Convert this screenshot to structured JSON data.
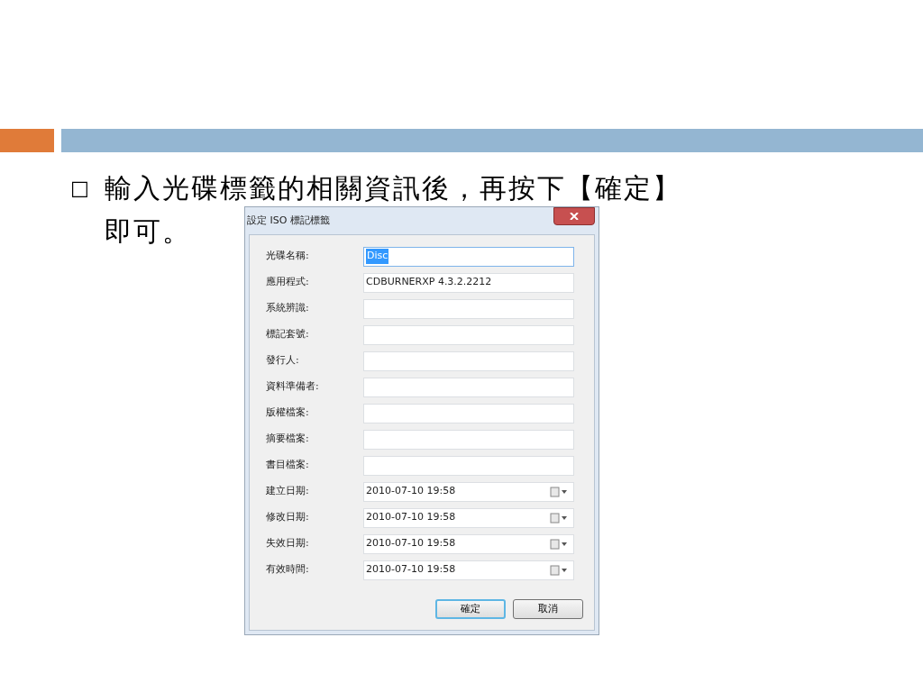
{
  "bullet": {
    "marker": "□",
    "lines": [
      "輸入光碟標籤的相關資訊後，再按下【確定】",
      "即可。"
    ]
  },
  "dialog": {
    "title": "設定 ISO 標記標籤",
    "fields": [
      {
        "label": "光碟名稱:",
        "kind": "text",
        "value": "Disc",
        "highlighted": true
      },
      {
        "label": "應用程式:",
        "kind": "text",
        "value": "CDBURNERXP 4.3.2.2212",
        "highlighted": false
      },
      {
        "label": "系統辨識:",
        "kind": "text",
        "highlighted": false
      },
      {
        "label": "標記套號:",
        "kind": "text",
        "highlighted": false
      },
      {
        "label": "發行人:",
        "kind": "text",
        "highlighted": false
      },
      {
        "label": "資料準備者:",
        "kind": "text",
        "highlighted": false
      },
      {
        "label": "版權檔案:",
        "kind": "text",
        "highlighted": false
      },
      {
        "label": "摘要檔案:",
        "kind": "text",
        "highlighted": false
      },
      {
        "label": "書目檔案:",
        "kind": "text",
        "highlighted": false
      },
      {
        "label": "建立日期:",
        "kind": "date",
        "value": "2010-07-10 19:58",
        "highlighted": false
      },
      {
        "label": "修改日期:",
        "kind": "date",
        "value": "2010-07-10 19:58",
        "highlighted": false
      },
      {
        "label": "失效日期:",
        "kind": "date",
        "value": "2010-07-10 19:58",
        "highlighted": false
      },
      {
        "label": "有效時間:",
        "kind": "date",
        "value": "2010-07-10 19:58",
        "highlighted": false
      }
    ],
    "buttons": [
      {
        "label": "確定",
        "default": true
      },
      {
        "label": "取消",
        "default": false
      }
    ]
  }
}
